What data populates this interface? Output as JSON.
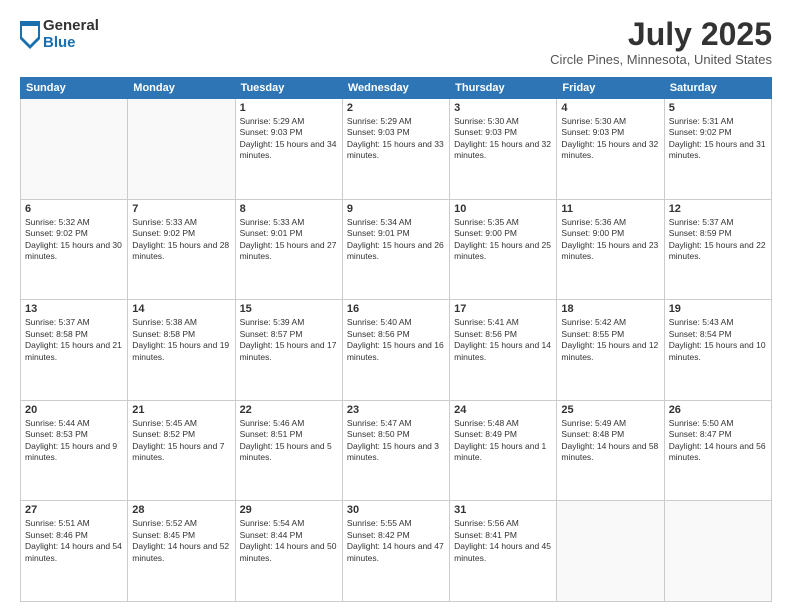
{
  "header": {
    "logo_general": "General",
    "logo_blue": "Blue",
    "month_year": "July 2025",
    "location": "Circle Pines, Minnesota, United States"
  },
  "weekdays": [
    "Sunday",
    "Monday",
    "Tuesday",
    "Wednesday",
    "Thursday",
    "Friday",
    "Saturday"
  ],
  "weeks": [
    [
      {
        "day": "",
        "empty": true
      },
      {
        "day": "",
        "empty": true
      },
      {
        "day": "1",
        "sunrise": "5:29 AM",
        "sunset": "9:03 PM",
        "daylight": "15 hours and 34 minutes."
      },
      {
        "day": "2",
        "sunrise": "5:29 AM",
        "sunset": "9:03 PM",
        "daylight": "15 hours and 33 minutes."
      },
      {
        "day": "3",
        "sunrise": "5:30 AM",
        "sunset": "9:03 PM",
        "daylight": "15 hours and 32 minutes."
      },
      {
        "day": "4",
        "sunrise": "5:30 AM",
        "sunset": "9:03 PM",
        "daylight": "15 hours and 32 minutes."
      },
      {
        "day": "5",
        "sunrise": "5:31 AM",
        "sunset": "9:02 PM",
        "daylight": "15 hours and 31 minutes."
      }
    ],
    [
      {
        "day": "6",
        "sunrise": "5:32 AM",
        "sunset": "9:02 PM",
        "daylight": "15 hours and 30 minutes."
      },
      {
        "day": "7",
        "sunrise": "5:33 AM",
        "sunset": "9:02 PM",
        "daylight": "15 hours and 28 minutes."
      },
      {
        "day": "8",
        "sunrise": "5:33 AM",
        "sunset": "9:01 PM",
        "daylight": "15 hours and 27 minutes."
      },
      {
        "day": "9",
        "sunrise": "5:34 AM",
        "sunset": "9:01 PM",
        "daylight": "15 hours and 26 minutes."
      },
      {
        "day": "10",
        "sunrise": "5:35 AM",
        "sunset": "9:00 PM",
        "daylight": "15 hours and 25 minutes."
      },
      {
        "day": "11",
        "sunrise": "5:36 AM",
        "sunset": "9:00 PM",
        "daylight": "15 hours and 23 minutes."
      },
      {
        "day": "12",
        "sunrise": "5:37 AM",
        "sunset": "8:59 PM",
        "daylight": "15 hours and 22 minutes."
      }
    ],
    [
      {
        "day": "13",
        "sunrise": "5:37 AM",
        "sunset": "8:58 PM",
        "daylight": "15 hours and 21 minutes."
      },
      {
        "day": "14",
        "sunrise": "5:38 AM",
        "sunset": "8:58 PM",
        "daylight": "15 hours and 19 minutes."
      },
      {
        "day": "15",
        "sunrise": "5:39 AM",
        "sunset": "8:57 PM",
        "daylight": "15 hours and 17 minutes."
      },
      {
        "day": "16",
        "sunrise": "5:40 AM",
        "sunset": "8:56 PM",
        "daylight": "15 hours and 16 minutes."
      },
      {
        "day": "17",
        "sunrise": "5:41 AM",
        "sunset": "8:56 PM",
        "daylight": "15 hours and 14 minutes."
      },
      {
        "day": "18",
        "sunrise": "5:42 AM",
        "sunset": "8:55 PM",
        "daylight": "15 hours and 12 minutes."
      },
      {
        "day": "19",
        "sunrise": "5:43 AM",
        "sunset": "8:54 PM",
        "daylight": "15 hours and 10 minutes."
      }
    ],
    [
      {
        "day": "20",
        "sunrise": "5:44 AM",
        "sunset": "8:53 PM",
        "daylight": "15 hours and 9 minutes."
      },
      {
        "day": "21",
        "sunrise": "5:45 AM",
        "sunset": "8:52 PM",
        "daylight": "15 hours and 7 minutes."
      },
      {
        "day": "22",
        "sunrise": "5:46 AM",
        "sunset": "8:51 PM",
        "daylight": "15 hours and 5 minutes."
      },
      {
        "day": "23",
        "sunrise": "5:47 AM",
        "sunset": "8:50 PM",
        "daylight": "15 hours and 3 minutes."
      },
      {
        "day": "24",
        "sunrise": "5:48 AM",
        "sunset": "8:49 PM",
        "daylight": "15 hours and 1 minute."
      },
      {
        "day": "25",
        "sunrise": "5:49 AM",
        "sunset": "8:48 PM",
        "daylight": "14 hours and 58 minutes."
      },
      {
        "day": "26",
        "sunrise": "5:50 AM",
        "sunset": "8:47 PM",
        "daylight": "14 hours and 56 minutes."
      }
    ],
    [
      {
        "day": "27",
        "sunrise": "5:51 AM",
        "sunset": "8:46 PM",
        "daylight": "14 hours and 54 minutes."
      },
      {
        "day": "28",
        "sunrise": "5:52 AM",
        "sunset": "8:45 PM",
        "daylight": "14 hours and 52 minutes."
      },
      {
        "day": "29",
        "sunrise": "5:54 AM",
        "sunset": "8:44 PM",
        "daylight": "14 hours and 50 minutes."
      },
      {
        "day": "30",
        "sunrise": "5:55 AM",
        "sunset": "8:42 PM",
        "daylight": "14 hours and 47 minutes."
      },
      {
        "day": "31",
        "sunrise": "5:56 AM",
        "sunset": "8:41 PM",
        "daylight": "14 hours and 45 minutes."
      },
      {
        "day": "",
        "empty": true
      },
      {
        "day": "",
        "empty": true
      }
    ]
  ]
}
